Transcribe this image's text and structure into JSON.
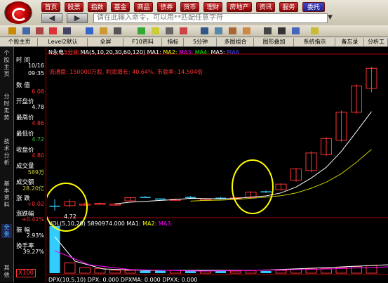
{
  "nav": {
    "items": [
      "首页",
      "股票",
      "指数",
      "基金",
      "商品",
      "债券",
      "货币",
      "理财",
      "房地产",
      "资讯",
      "服务",
      "委托"
    ],
    "active": "委托"
  },
  "command": {
    "placeholder": "请在此输入命令，可以用**匹配任意字符"
  },
  "tabs": [
    "个股主页",
    "Level2默认",
    "全屏",
    "F10资料",
    "指标",
    "5分钟",
    "多图组合",
    "图形叠加",
    "系统指示",
    "备忘录",
    "分析工"
  ],
  "side_tabs": [
    "个股主页",
    "分时走势",
    "技术分析",
    "基本资料",
    "全景",
    "其他"
  ],
  "side_active": "全景",
  "info": {
    "time_label": "时 间",
    "date": "10/16",
    "time": "09:35",
    "value_label": "数 值",
    "value": "6.08",
    "open_label": "开盘价",
    "open": "4.78",
    "high_label": "最高价",
    "high": "4.86",
    "low_label": "最低价",
    "low": "4.72",
    "close_label": "收盘价",
    "close": "4.80",
    "vol_label": "成交量",
    "vol": "589万",
    "amt_label": "成交额",
    "amt": "28.20亿",
    "chg_label": "涨 跌",
    "chg": "+0.02",
    "chgp_label": "涨跌幅",
    "chgp": "+0.42%",
    "amp_label": "振 幅",
    "amp": "2.93%",
    "turn_label": "换手率",
    "turn": "39.27%",
    "zoom": "X100"
  },
  "header": {
    "stock": "N永电",
    "period": "5分钟",
    "ma": "MA(5,10,20,30,60,120)",
    "ma1": "MA1:",
    "ma2": "MA2:",
    "ma3": "MA3:",
    "ma4": "MA4:",
    "ma5": "MA5:",
    "ma6": "MA6"
  },
  "stats": "流通盘: 150000万股, 利润增长: 40.64%, 市盈率: 14.504倍",
  "vol_header": {
    "name": "VOL(5,10,20)",
    "value": "5890974.000",
    "ma1": "MA1:",
    "ma2": "MA2:",
    "ma3": "MA3:"
  },
  "bottom_header": "DPX(10,5,10) DPX: 0.000 DPXMA: 0.000 DPXX: 0.000",
  "low_marker": "4.72",
  "colors": {
    "up": "#ff3333",
    "down": "#33ccff",
    "ma1": "#ffffff",
    "ma2": "#cccc00",
    "accent": "#ffff00"
  },
  "chart_data": {
    "type": "candlestick",
    "period": "5分钟",
    "candles": [
      {
        "o": 4.78,
        "c": 4.77,
        "h": 4.86,
        "l": 4.72
      },
      {
        "o": 4.78,
        "c": 4.83,
        "h": 4.86,
        "l": 4.76
      },
      {
        "o": 4.8,
        "c": 4.8,
        "h": 4.82,
        "l": 4.78
      },
      {
        "o": 4.8,
        "c": 4.81,
        "h": 4.82,
        "l": 4.8
      },
      {
        "o": 4.8,
        "c": 4.8,
        "h": 4.81,
        "l": 4.79
      },
      {
        "o": 4.84,
        "c": 4.88,
        "h": 4.88,
        "l": 4.84
      },
      {
        "o": 4.89,
        "c": 4.88,
        "h": 4.9,
        "l": 4.88
      },
      {
        "o": 4.87,
        "c": 4.86,
        "h": 4.87,
        "l": 4.86
      },
      {
        "o": 4.85,
        "c": 4.86,
        "h": 4.87,
        "l": 4.85
      },
      {
        "o": 4.89,
        "c": 4.88,
        "h": 4.9,
        "l": 4.88
      },
      {
        "o": 4.86,
        "c": 4.86,
        "h": 4.87,
        "l": 4.85
      },
      {
        "o": 4.88,
        "c": 4.87,
        "h": 4.89,
        "l": 4.86
      },
      {
        "o": 4.87,
        "c": 4.88,
        "h": 4.89,
        "l": 4.86
      },
      {
        "o": 4.88,
        "c": 4.95,
        "h": 4.96,
        "l": 4.87
      },
      {
        "o": 4.96,
        "c": 4.95,
        "h": 4.97,
        "l": 4.94
      },
      {
        "o": 4.98,
        "c": 5.05,
        "h": 5.06,
        "l": 4.97
      },
      {
        "o": 5.1,
        "c": 5.24,
        "h": 5.25,
        "l": 5.08
      },
      {
        "o": 5.22,
        "c": 5.44,
        "h": 5.46,
        "l": 5.2
      },
      {
        "o": 5.42,
        "c": 5.62,
        "h": 5.64,
        "l": 5.4
      },
      {
        "o": 5.6,
        "c": 5.95,
        "h": 5.97,
        "l": 5.58
      },
      {
        "o": 5.95,
        "c": 6.28,
        "h": 6.3,
        "l": 5.93
      },
      {
        "o": 6.25,
        "c": 6.5,
        "h": 6.52,
        "l": 6.2
      }
    ],
    "volume": [
      100,
      22,
      12,
      10,
      6,
      6,
      5,
      5,
      6,
      5,
      4,
      4,
      4,
      5,
      4,
      6,
      8,
      9,
      10,
      12,
      14,
      16
    ]
  }
}
